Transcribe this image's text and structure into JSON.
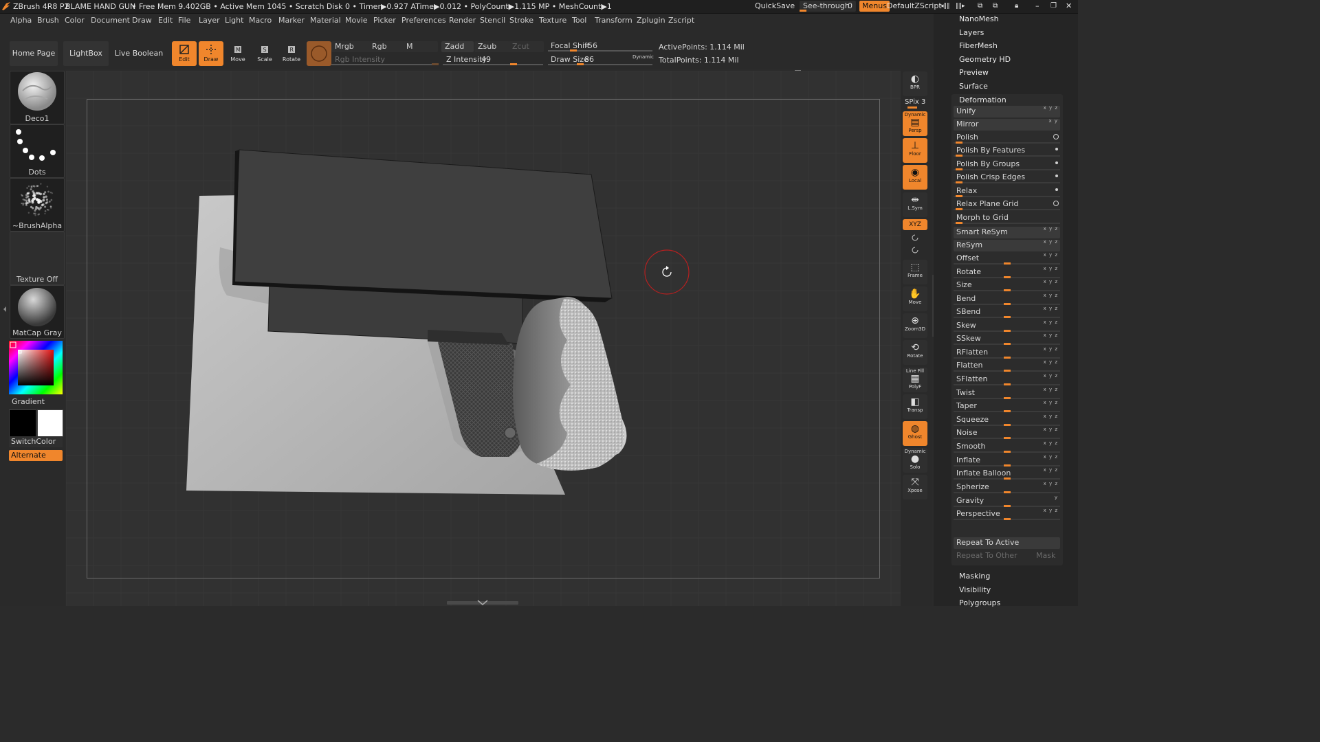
{
  "titlebar": {
    "app": "ZBrush 4R8 P2",
    "project": "BLAME HAND GUN",
    "stats": "• Free Mem 9.402GB • Active Mem 1045 • Scratch Disk 0 • Timer▶0.927 ATime▶0.012 • PolyCount▶1.115 MP • MeshCount▶1",
    "quicksave": "QuickSave",
    "see_through_label": "See-through",
    "see_through_value": "0",
    "menus": "Menus",
    "script": "DefaultZScript"
  },
  "menubar": [
    "Alpha",
    "Brush",
    "Color",
    "Document",
    "Draw",
    "Edit",
    "File",
    "Layer",
    "Light",
    "Macro",
    "Marker",
    "Material",
    "Movie",
    "Picker",
    "Preferences",
    "Render",
    "Stencil",
    "Stroke",
    "Texture",
    "Tool",
    "Transform",
    "Zplugin",
    "Zscript"
  ],
  "toolbar": {
    "home_page": "Home Page",
    "lightbox": "LightBox",
    "live_boolean": "Live Boolean",
    "tools": [
      {
        "label": "Edit",
        "active": true
      },
      {
        "label": "Draw",
        "active": true
      },
      {
        "label": "Move",
        "active": false
      },
      {
        "label": "Scale",
        "active": false
      },
      {
        "label": "Rotate",
        "active": false
      }
    ],
    "mrgb": "Mrgb",
    "rgb": "Rgb",
    "m": "M",
    "rgb_intensity": "Rgb Intensity",
    "zadd": "Zadd",
    "zsub": "Zsub",
    "zcut": "Zcut",
    "z_intensity_label": "Z Intensity",
    "z_intensity_value": "49",
    "focal_shift_label": "Focal Shift",
    "focal_shift_value": "-56",
    "draw_size_label": "Draw Size",
    "draw_size_value": "86",
    "dynamic": "Dynamic",
    "active_points": "ActivePoints: 1.114 Mil",
    "total_points": "TotalPoints: 1.114 Mil"
  },
  "leftshelf": {
    "brush": "Deco1",
    "stroke": "Dots",
    "alpha": "~BrushAlpha",
    "texture": "Texture Off",
    "material": "MatCap Gray",
    "gradient": "Gradient",
    "switch_color": "SwitchColor",
    "alternate": "Alternate"
  },
  "rightshelf": {
    "spix": "SPix 3",
    "tools": [
      {
        "label": "BPR",
        "active": false
      },
      {
        "label": "Persp",
        "top": "Dynamic",
        "active": true
      },
      {
        "label": "Floor",
        "active": true
      },
      {
        "label": "Local",
        "active": true
      },
      {
        "label": "L.Sym",
        "active": false
      },
      {
        "label": "Frame",
        "active": false
      },
      {
        "label": "Move",
        "active": false
      },
      {
        "label": "Zoom3D",
        "active": false
      },
      {
        "label": "Rotate",
        "active": false
      },
      {
        "label": "PolyF",
        "top": "Line Fill",
        "active": false
      },
      {
        "label": "Transp",
        "active": false
      },
      {
        "label": "Ghost",
        "active": true
      },
      {
        "label": "Solo",
        "top": "Dynamic",
        "active": false
      },
      {
        "label": "Xpose",
        "active": false
      }
    ],
    "xyz": "XYZ"
  },
  "panel": {
    "top_links": [
      "NanoMesh",
      "Layers",
      "FiberMesh",
      "Geometry HD",
      "Preview",
      "Surface"
    ],
    "section": "Deformation",
    "items": [
      {
        "name": "Unify",
        "type": "button",
        "axis": "xyz"
      },
      {
        "name": "Mirror",
        "type": "button",
        "axis": "xy"
      },
      {
        "name": "Polish",
        "type": "slider",
        "knob": 0.02,
        "marker": "circle"
      },
      {
        "name": "Polish By Features",
        "type": "slider",
        "knob": 0.02,
        "marker": "dot"
      },
      {
        "name": "Polish By Groups",
        "type": "slider",
        "knob": 0.02,
        "marker": "dot"
      },
      {
        "name": "Polish Crisp Edges",
        "type": "slider",
        "knob": 0.02,
        "marker": "dot"
      },
      {
        "name": "Relax",
        "type": "slider",
        "knob": 0.02,
        "marker": "dot"
      },
      {
        "name": "Relax Plane Grid",
        "type": "slider",
        "knob": 0.02,
        "marker": "circle"
      },
      {
        "name": "Morph to Grid",
        "type": "slider",
        "knob": 0.02
      },
      {
        "name": "Smart ReSym",
        "type": "button",
        "axis": "xyz"
      },
      {
        "name": "ReSym",
        "type": "button",
        "axis": "xyz"
      },
      {
        "name": "Offset",
        "type": "slider",
        "knob": 0.5,
        "axis": "xyz"
      },
      {
        "name": "Rotate",
        "type": "slider",
        "knob": 0.5,
        "axis": "xyz"
      },
      {
        "name": "Size",
        "type": "slider",
        "knob": 0.5,
        "axis": "xyz"
      },
      {
        "name": "Bend",
        "type": "slider",
        "knob": 0.5,
        "axis": "xyz"
      },
      {
        "name": "SBend",
        "type": "slider",
        "knob": 0.5,
        "axis": "xyz"
      },
      {
        "name": "Skew",
        "type": "slider",
        "knob": 0.5,
        "axis": "xyz"
      },
      {
        "name": "SSkew",
        "type": "slider",
        "knob": 0.5,
        "axis": "xyz"
      },
      {
        "name": "RFlatten",
        "type": "slider",
        "knob": 0.5,
        "axis": "xyz"
      },
      {
        "name": "Flatten",
        "type": "slider",
        "knob": 0.5,
        "axis": "xyz"
      },
      {
        "name": "SFlatten",
        "type": "slider",
        "knob": 0.5,
        "axis": "xyz"
      },
      {
        "name": "Twist",
        "type": "slider",
        "knob": 0.5,
        "axis": "xyz"
      },
      {
        "name": "Taper",
        "type": "slider",
        "knob": 0.5,
        "axis": "xyz"
      },
      {
        "name": "Squeeze",
        "type": "slider",
        "knob": 0.5,
        "axis": "xyz"
      },
      {
        "name": "Noise",
        "type": "slider",
        "knob": 0.5,
        "axis": "xyz"
      },
      {
        "name": "Smooth",
        "type": "slider",
        "knob": 0.5,
        "axis": "xyz"
      },
      {
        "name": "Inflate",
        "type": "slider",
        "knob": 0.5,
        "axis": "xyz"
      },
      {
        "name": "Inflate Balloon",
        "type": "slider",
        "knob": 0.5,
        "axis": "xyz"
      },
      {
        "name": "Spherize",
        "type": "slider",
        "knob": 0.5,
        "axis": "xyz"
      },
      {
        "name": "Gravity",
        "type": "slider",
        "knob": 0.5,
        "axis": "y"
      },
      {
        "name": "Perspective",
        "type": "slider",
        "knob": 0.5,
        "axis": "xyz"
      }
    ],
    "repeat_active": "Repeat To Active",
    "repeat_other": "Repeat To Other",
    "mask": "Mask",
    "bottom_links": [
      "Masking",
      "Visibility",
      "Polygroups"
    ]
  },
  "colors": {
    "accent": "#f0862c",
    "panel": "#252525",
    "canvas": "#313131"
  }
}
